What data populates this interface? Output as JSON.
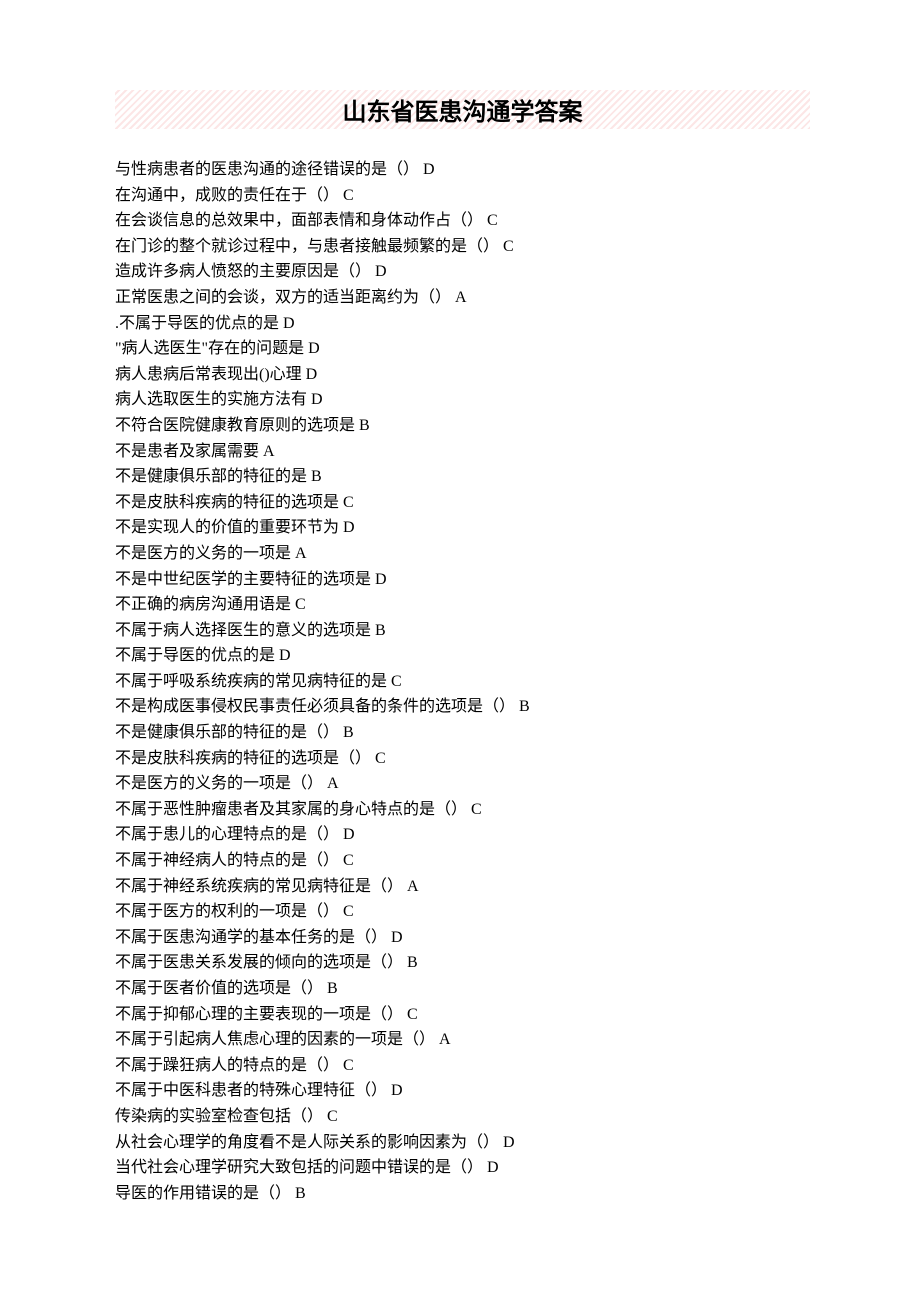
{
  "title": "山东省医患沟通学答案",
  "items": [
    {
      "q": "与性病患者的医患沟通的途径错误的是（）",
      "a": "D"
    },
    {
      "q": "在沟通中，成败的责任在于（）",
      "a": "C"
    },
    {
      "q": "在会谈信息的总效果中，面部表情和身体动作占（）",
      "a": "C"
    },
    {
      "q": "在门诊的整个就诊过程中，与患者接触最频繁的是（）",
      "a": "C"
    },
    {
      "q": "造成许多病人愤怒的主要原因是（）",
      "a": "D"
    },
    {
      "q": "正常医患之间的会谈，双方的适当距离约为（）",
      "a": "A"
    },
    {
      "q": ".不属于导医的优点的是",
      "a": "D"
    },
    {
      "q": "\"病人选医生\"存在的问题是",
      "a": "D"
    },
    {
      "q": "病人患病后常表现出()心理",
      "a": "D"
    },
    {
      "q": "病人选取医生的实施方法有",
      "a": "D"
    },
    {
      "q": "不符合医院健康教育原则的选项是",
      "a": "B"
    },
    {
      "q": "不是患者及家属需要",
      "a": "A"
    },
    {
      "q": "不是健康俱乐部的特征的是",
      "a": "B"
    },
    {
      "q": "不是皮肤科疾病的特征的选项是",
      "a": "C"
    },
    {
      "q": "不是实现人的价值的重要环节为",
      "a": "D"
    },
    {
      "q": "不是医方的义务的一项是",
      "a": "A"
    },
    {
      "q": "不是中世纪医学的主要特征的选项是",
      "a": "D"
    },
    {
      "q": "不正确的病房沟通用语是",
      "a": "C"
    },
    {
      "q": "不属于病人选择医生的意义的选项是",
      "a": "B"
    },
    {
      "q": "不属于导医的优点的是",
      "a": "D"
    },
    {
      "q": "不属于呼吸系统疾病的常见病特征的是",
      "a": "C"
    },
    {
      "q": "不是构成医事侵权民事责任必须具备的条件的选项是（）",
      "a": "B"
    },
    {
      "q": "不是健康俱乐部的特征的是（）",
      "a": "B"
    },
    {
      "q": "不是皮肤科疾病的特征的选项是（）",
      "a": "C"
    },
    {
      "q": "不是医方的义务的一项是（）",
      "a": "A"
    },
    {
      "q": "不属于恶性肿瘤患者及其家属的身心特点的是（）",
      "a": "C"
    },
    {
      "q": "不属于患儿的心理特点的是（）",
      "a": "D"
    },
    {
      "q": "不属于神经病人的特点的是（）",
      "a": "C"
    },
    {
      "q": "不属于神经系统疾病的常见病特征是（）",
      "a": "A"
    },
    {
      "q": "不属于医方的权利的一项是（）",
      "a": "C"
    },
    {
      "q": "不属于医患沟通学的基本任务的是（）",
      "a": "D"
    },
    {
      "q": "不属于医患关系发展的倾向的选项是（）",
      "a": "B"
    },
    {
      "q": "不属于医者价值的选项是（）",
      "a": "B"
    },
    {
      "q": "不属于抑郁心理的主要表现的一项是（）",
      "a": "C"
    },
    {
      "q": "不属于引起病人焦虑心理的因素的一项是（）",
      "a": "A"
    },
    {
      "q": "不属于躁狂病人的特点的是（）",
      "a": "C"
    },
    {
      "q": "不属于中医科患者的特殊心理特征（）",
      "a": "D"
    },
    {
      "q": "传染病的实验室检查包括（）",
      "a": "C"
    },
    {
      "q": "从社会心理学的角度看不是人际关系的影响因素为（）",
      "a": "D"
    },
    {
      "q": "当代社会心理学研究大致包括的问题中错误的是（）",
      "a": "D"
    },
    {
      "q": "导医的作用错误的是（）",
      "a": "B"
    }
  ]
}
